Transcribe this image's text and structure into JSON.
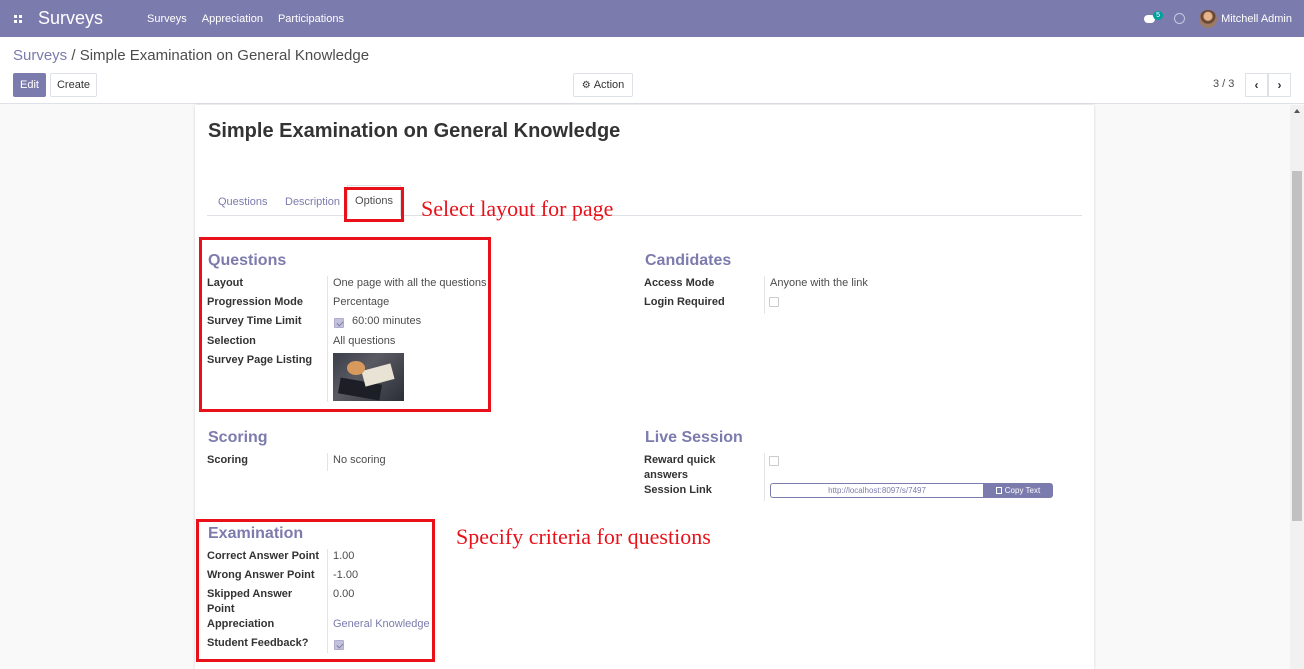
{
  "navbar": {
    "app_name": "Surveys",
    "menu": [
      "Surveys",
      "Appreciation",
      "Participations"
    ],
    "chat_badge": "5",
    "user_name": "Mitchell Admin"
  },
  "breadcrumb": {
    "parent": "Surveys",
    "separator": "/",
    "current": "Simple Examination on General Knowledge"
  },
  "buttons": {
    "edit": "Edit",
    "create": "Create",
    "action": "Action"
  },
  "pager": {
    "value": "3 / 3",
    "prev": "‹",
    "next": "›"
  },
  "record": {
    "title": "Simple Examination on General Knowledge"
  },
  "tabs": [
    "Questions",
    "Description",
    "Options"
  ],
  "annotations": {
    "layout": "Select layout for page",
    "criteria": "Specify criteria for questions"
  },
  "questions_group": {
    "title": "Questions",
    "fields": [
      {
        "label": "Layout",
        "value": "One page with all the questions"
      },
      {
        "label": "Progression Mode",
        "value": "Percentage"
      },
      {
        "label": "Survey Time Limit",
        "value": "60:00 minutes",
        "checked": true
      },
      {
        "label": "Selection",
        "value": "All questions"
      },
      {
        "label": "Survey Page Listing",
        "value": ""
      }
    ]
  },
  "candidates_group": {
    "title": "Candidates",
    "fields": [
      {
        "label": "Access Mode",
        "value": "Anyone with the link"
      },
      {
        "label": "Login Required",
        "checked": false
      }
    ]
  },
  "scoring_group": {
    "title": "Scoring",
    "fields": [
      {
        "label": "Scoring",
        "value": "No scoring"
      }
    ]
  },
  "live_session_group": {
    "title": "Live Session",
    "fields": [
      {
        "label": "Reward quick answers",
        "checked": false
      },
      {
        "label": "Session Link",
        "value": "http://localhost:8097/s/7497",
        "button": "Copy Text"
      }
    ]
  },
  "examination_group": {
    "title": "Examination",
    "fields": [
      {
        "label": "Correct Answer Point",
        "value": "1.00"
      },
      {
        "label": "Wrong Answer Point",
        "value": "-1.00"
      },
      {
        "label": "Skipped Answer Point",
        "value": "0.00"
      },
      {
        "label": "Appreciation",
        "value": "General Knowledge"
      },
      {
        "label": "Student Feedback?",
        "checked": true
      }
    ]
  },
  "colors": {
    "brand": "#7c7bad",
    "annotation": "#e8111a"
  }
}
